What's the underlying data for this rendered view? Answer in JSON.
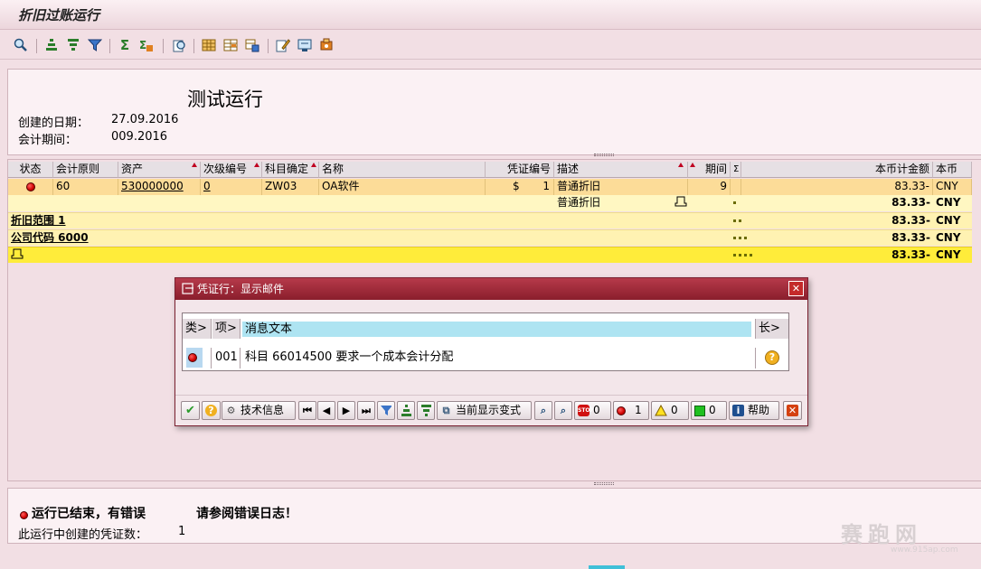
{
  "window": {
    "title": "折旧过账运行"
  },
  "toolbar": {
    "icons": [
      "details-icon",
      "sort-ascending-icon",
      "sort-descending-icon",
      "filter-icon",
      "sum-icon",
      "subtotal-icon",
      "print-preview-icon",
      "layout-icon",
      "change-layout-icon",
      "save-layout-icon",
      "edit-icon",
      "export-icon",
      "local-file-icon"
    ]
  },
  "header": {
    "run_title": "测试运行",
    "created_label": "创建的日期：",
    "created_value": "27.09.2016",
    "period_label": "会计期间：",
    "period_value": "009.2016"
  },
  "grid": {
    "columns": [
      "状态",
      "会计原则",
      "资产",
      "次级编号",
      "科目确定",
      "名称",
      "凭证编号",
      "描述",
      "期间",
      "Σ",
      "本币计金额",
      "本币"
    ],
    "row1": {
      "principle": "60",
      "asset": "530000000",
      "sub": "0",
      "account": "ZW03",
      "name": "OA软件",
      "doc_currency": "$",
      "doc_no": "1",
      "desc": "普通折旧",
      "period": "9",
      "amount": "83.33-",
      "currency": "CNY"
    },
    "row2": {
      "desc": "普通折旧",
      "amount": "83.33-",
      "currency": "CNY"
    },
    "row3": {
      "label": "折旧范围  1",
      "amount": "83.33-",
      "currency": "CNY"
    },
    "row4": {
      "label": "公司代码 6000",
      "amount": "83.33-",
      "currency": "CNY"
    },
    "row5": {
      "amount": "83.33-",
      "currency": "CNY"
    }
  },
  "dialog": {
    "title": "凭证行：显示邮件",
    "close": "✕",
    "col_type": "类>",
    "col_item": "项>",
    "col_text": "消息文本",
    "col_len": "长>",
    "message": {
      "item": "001",
      "text": "科目  66014500 要求一个成本会计分配"
    },
    "buttons": {
      "tech_info": "技术信息",
      "current_variant": "当前显示变式",
      "stop_count": "0",
      "error_count": "1",
      "warning_count": "0",
      "success_count": "0",
      "help": "帮助"
    }
  },
  "status": {
    "result": "运行已结束，有错误",
    "advice": "请参阅错误日志！",
    "docs_label": "此运行中创建的凭证数：",
    "docs_value": "1"
  },
  "watermark": {
    "text": "赛跑网",
    "url": "www.915ap.com"
  }
}
